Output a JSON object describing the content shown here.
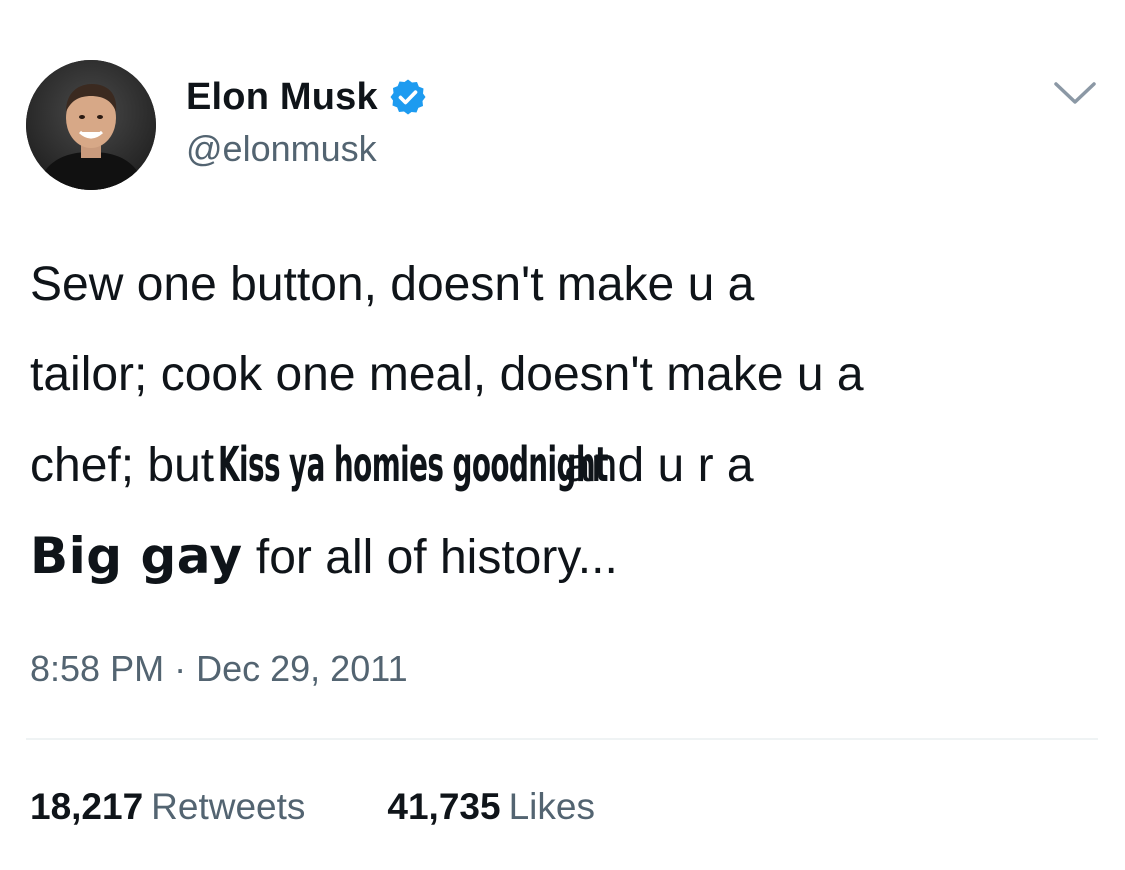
{
  "user": {
    "display_name": "Elon Musk",
    "handle": "@elonmusk",
    "verified": true,
    "avatar_icon": "profile-photo"
  },
  "tweet": {
    "line1": "Sew one button, doesn't make u a",
    "line2": "tailor; cook one meal, doesn't make u a",
    "line3_pre": "chef; but",
    "line3_overlay": "Kiss ya homies goodnight",
    "line3_post": "and u r a",
    "line4_bold": "Big gay",
    "line4_rest": "for all of history..."
  },
  "timestamp": {
    "time": "8:58 PM",
    "separator": "·",
    "date": "Dec 29, 2011"
  },
  "stats": {
    "retweets_count": "18,217",
    "retweets_label": "Retweets",
    "likes_count": "41,735",
    "likes_label": "Likes"
  },
  "icons": {
    "verified": "verified-badge-icon",
    "menu": "chevron-down-icon"
  },
  "colors": {
    "text_primary": "#0f1419",
    "text_secondary": "#536471",
    "verified_blue": "#1d9bf0",
    "divider": "#eff3f4"
  }
}
